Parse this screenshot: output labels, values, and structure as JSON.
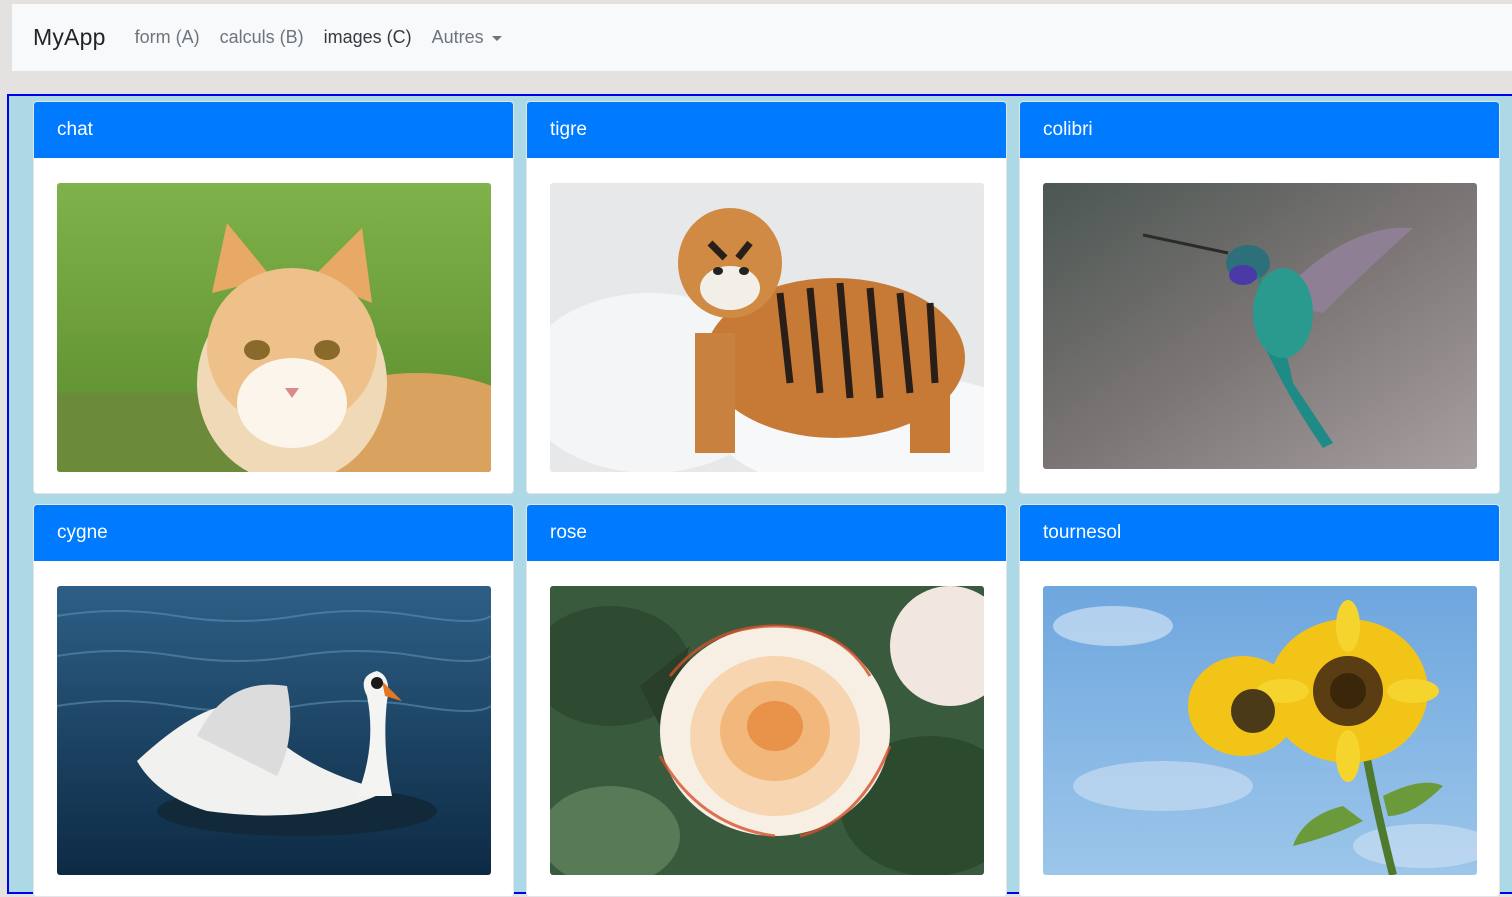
{
  "navbar": {
    "brand": "MyApp",
    "links": [
      {
        "label": "form (A)"
      },
      {
        "label": "calculs (B)"
      },
      {
        "label": "images (C)"
      }
    ],
    "dropdown": {
      "label": "Autres"
    }
  },
  "cards": [
    {
      "title": "chat",
      "image": "cat-photo"
    },
    {
      "title": "tigre",
      "image": "tiger-photo"
    },
    {
      "title": "colibri",
      "image": "hummingbird-photo"
    },
    {
      "title": "cygne",
      "image": "swan-photo"
    },
    {
      "title": "rose",
      "image": "rose-photo"
    },
    {
      "title": "tournesol",
      "image": "sunflower-photo"
    }
  ],
  "colors": {
    "card_header": "#007bff",
    "content_background": "#add8e6",
    "content_border": "#0000ee",
    "navbar_background": "#f8f9fa"
  }
}
